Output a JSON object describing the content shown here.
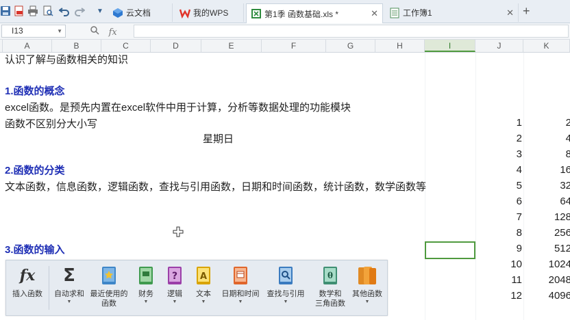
{
  "toolbar": {
    "quick_icons": [
      "save-icon",
      "export-pdf-icon",
      "print-icon",
      "print-preview-icon",
      "undo-icon",
      "redo-icon",
      "customize-dropdown-icon"
    ]
  },
  "tabs": [
    {
      "label": "云文档",
      "icon": "cloud-docs-icon",
      "active": false
    },
    {
      "label": "我的WPS",
      "icon": "wps-logo-icon",
      "active": false
    },
    {
      "label": "第1季  函数基础.xls *",
      "icon": "spreadsheet-icon",
      "active": true
    },
    {
      "label": "工作簿1",
      "icon": "spreadsheet-icon",
      "active": false
    }
  ],
  "formula_bar": {
    "name_box": "I13",
    "fx_label": "fx",
    "value": ""
  },
  "columns": [
    "A",
    "B",
    "C",
    "D",
    "E",
    "F",
    "G",
    "H",
    "I",
    "J",
    "K"
  ],
  "selected_column": "I",
  "sheet": {
    "line1": "认识了解与函数相关的知识",
    "h1": "1.函数的概念",
    "line2": "excel函数。是预先内置在excel软件中用于计算，分析等数据处理的功能模块",
    "line3": "函数不区别分大小写",
    "weekday": "星期日",
    "h2": "2.函数的分类",
    "line4": "文本函数，信息函数，逻辑函数，查找与引用函数，日期和时间函数，统计函数，数学函数等",
    "h3": "3.函数的输入",
    "col_j": [
      "1",
      "2",
      "3",
      "4",
      "5",
      "6",
      "7",
      "8",
      "9",
      "10",
      "11",
      "12"
    ],
    "col_k": [
      "2",
      "4",
      "8",
      "16",
      "32",
      "64",
      "128",
      "256",
      "512",
      "1024",
      "2048",
      "4096"
    ]
  },
  "ribbon": {
    "buttons": [
      {
        "label": "插入函数",
        "icon": "insert-function-fx-icon"
      },
      {
        "label": "自动求和",
        "icon": "autosum-sigma-icon",
        "dropdown": true
      },
      {
        "label": "最近使用的\n函数",
        "icon": "recent-functions-book-icon",
        "dropdown": true
      },
      {
        "label": "财务",
        "icon": "financial-book-icon",
        "dropdown": true
      },
      {
        "label": "逻辑",
        "icon": "logical-book-icon",
        "dropdown": true
      },
      {
        "label": "文本",
        "icon": "text-book-icon",
        "dropdown": true
      },
      {
        "label": "日期和时间",
        "icon": "date-time-book-icon",
        "dropdown": true
      },
      {
        "label": "查找与引用",
        "icon": "lookup-reference-book-icon",
        "dropdown": true
      },
      {
        "label": "数学和\n三角函数",
        "icon": "math-trig-book-icon",
        "dropdown": true
      },
      {
        "label": "其他函数",
        "icon": "more-functions-books-icon",
        "dropdown": true
      }
    ]
  },
  "colors": {
    "heading": "#1f2fb5",
    "selection": "#4f9a3e",
    "tabbar": "#e9eef4"
  }
}
